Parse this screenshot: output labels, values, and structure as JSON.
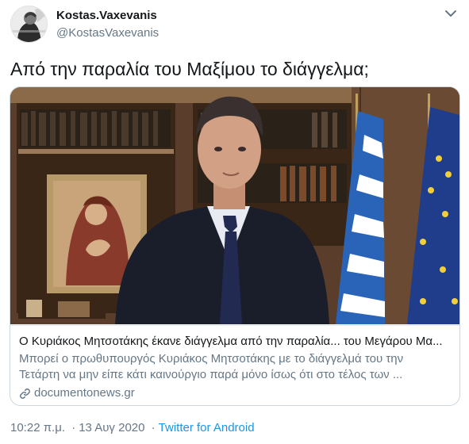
{
  "author": {
    "display_name": "Kostas.Vaxevanis",
    "handle": "@KostasVaxevanis"
  },
  "tweet": {
    "text": "Από την παραλία του Μαξίμου το διάγγελμα;"
  },
  "card": {
    "title": "Ο Κυριάκος Μητσοτάκης έκανε διάγγελμα από την παραλία... του Μεγάρου Μα...",
    "description_lines": [
      "Μπορεί ο πρωθυπουργός Κυριάκος Μητσοτάκης με το διάγγελμά του την",
      "Τετάρτη να μην είπε κάτι καινούργιο παρά μόνο ίσως ότι στο τέλος των ..."
    ],
    "domain": "documentonews.gr"
  },
  "meta": {
    "time": "10:22 π.μ.",
    "separator": "·",
    "date": "13 Αυγ 2020",
    "source": "Twitter for Android"
  },
  "icons": {
    "menu": "chevron-down-icon",
    "link": "link-icon"
  },
  "colors": {
    "text_primary": "#14171a",
    "text_secondary": "#657786",
    "link_blue": "#1b95e0",
    "border": "#ccd6dd"
  }
}
